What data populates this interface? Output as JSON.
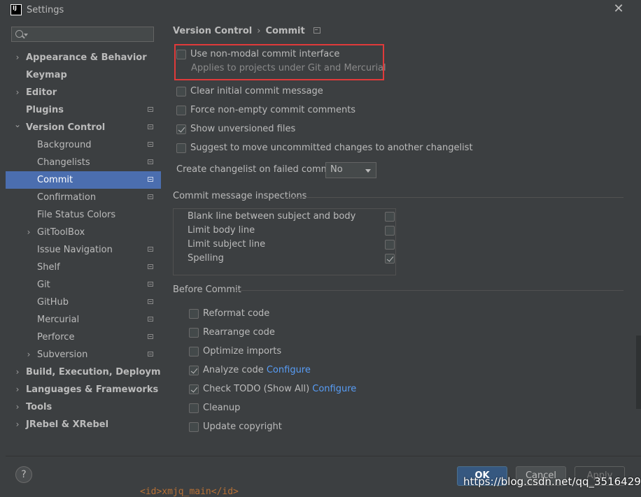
{
  "window": {
    "title": "Settings",
    "logo_text": "IJ",
    "close_glyph": "✕"
  },
  "sidebar": {
    "search_placeholder": "",
    "items": [
      {
        "label": "Appearance & Behavior",
        "level": 0,
        "bold": true,
        "arrow": "right",
        "icon": false
      },
      {
        "label": "Keymap",
        "level": 0,
        "bold": true,
        "arrow": "",
        "icon": false
      },
      {
        "label": "Editor",
        "level": 0,
        "bold": true,
        "arrow": "right",
        "icon": false
      },
      {
        "label": "Plugins",
        "level": 0,
        "bold": true,
        "arrow": "",
        "icon": true
      },
      {
        "label": "Version Control",
        "level": 0,
        "bold": true,
        "arrow": "down",
        "icon": true
      },
      {
        "label": "Background",
        "level": 1,
        "bold": false,
        "arrow": "",
        "icon": true
      },
      {
        "label": "Changelists",
        "level": 1,
        "bold": false,
        "arrow": "",
        "icon": true
      },
      {
        "label": "Commit",
        "level": 1,
        "bold": false,
        "arrow": "",
        "icon": true,
        "selected": true
      },
      {
        "label": "Confirmation",
        "level": 1,
        "bold": false,
        "arrow": "",
        "icon": true
      },
      {
        "label": "File Status Colors",
        "level": 1,
        "bold": false,
        "arrow": "",
        "icon": false
      },
      {
        "label": "GitToolBox",
        "level": 1,
        "bold": false,
        "arrow": "right",
        "icon": false
      },
      {
        "label": "Issue Navigation",
        "level": 1,
        "bold": false,
        "arrow": "",
        "icon": true
      },
      {
        "label": "Shelf",
        "level": 1,
        "bold": false,
        "arrow": "",
        "icon": true
      },
      {
        "label": "Git",
        "level": 1,
        "bold": false,
        "arrow": "",
        "icon": true
      },
      {
        "label": "GitHub",
        "level": 1,
        "bold": false,
        "arrow": "",
        "icon": true
      },
      {
        "label": "Mercurial",
        "level": 1,
        "bold": false,
        "arrow": "",
        "icon": true
      },
      {
        "label": "Perforce",
        "level": 1,
        "bold": false,
        "arrow": "",
        "icon": true
      },
      {
        "label": "Subversion",
        "level": 1,
        "bold": false,
        "arrow": "right",
        "icon": true
      },
      {
        "label": "Build, Execution, Deployment",
        "level": 0,
        "bold": true,
        "arrow": "right",
        "icon": false
      },
      {
        "label": "Languages & Frameworks",
        "level": 0,
        "bold": true,
        "arrow": "right",
        "icon": false
      },
      {
        "label": "Tools",
        "level": 0,
        "bold": true,
        "arrow": "right",
        "icon": false
      },
      {
        "label": "JRebel & XRebel",
        "level": 0,
        "bold": true,
        "arrow": "right",
        "icon": false
      }
    ]
  },
  "main": {
    "breadcrumb": {
      "parent": "Version Control",
      "separator": "›",
      "current": "Commit"
    },
    "non_modal": {
      "label": "Use non-modal commit interface",
      "checked": false,
      "hint": "Applies to projects under Git and Mercurial"
    },
    "options": [
      {
        "label": "Clear initial commit message",
        "checked": false
      },
      {
        "label": "Force non-empty commit comments",
        "checked": false
      },
      {
        "label": "Show unversioned files",
        "checked": true
      },
      {
        "label": "Suggest to move uncommitted changes to another changelist",
        "checked": false
      }
    ],
    "changelist_combo": {
      "label": "Create changelist on failed commit:",
      "value": "No"
    },
    "inspections": {
      "title": "Commit message inspections",
      "rows": [
        {
          "label": "Blank line between subject and body",
          "checked": false
        },
        {
          "label": "Limit body line",
          "checked": false
        },
        {
          "label": "Limit subject line",
          "checked": false
        },
        {
          "label": "Spelling",
          "checked": true
        }
      ]
    },
    "before_commit": {
      "title": "Before Commit",
      "items": [
        {
          "label": "Reformat code",
          "checked": false,
          "link": ""
        },
        {
          "label": "Rearrange code",
          "checked": false,
          "link": ""
        },
        {
          "label": "Optimize imports",
          "checked": false,
          "link": ""
        },
        {
          "label": "Analyze code",
          "checked": true,
          "link": "Configure"
        },
        {
          "label": "Check TODO (Show All)",
          "checked": true,
          "link": "Configure"
        },
        {
          "label": "Cleanup",
          "checked": false,
          "link": ""
        },
        {
          "label": "Update copyright",
          "checked": false,
          "link": ""
        }
      ]
    }
  },
  "buttons": {
    "help": "?",
    "ok": "OK",
    "cancel": "Cancel",
    "apply": "Apply"
  },
  "watermark": "https://blog.csdn.net/qq_35164294",
  "background_snippet": "<id>xmjq_main</id>",
  "colors": {
    "selection": "#4b6eaf",
    "highlight_box": "#e03a3a",
    "link": "#589df6",
    "ok_button": "#365880"
  }
}
